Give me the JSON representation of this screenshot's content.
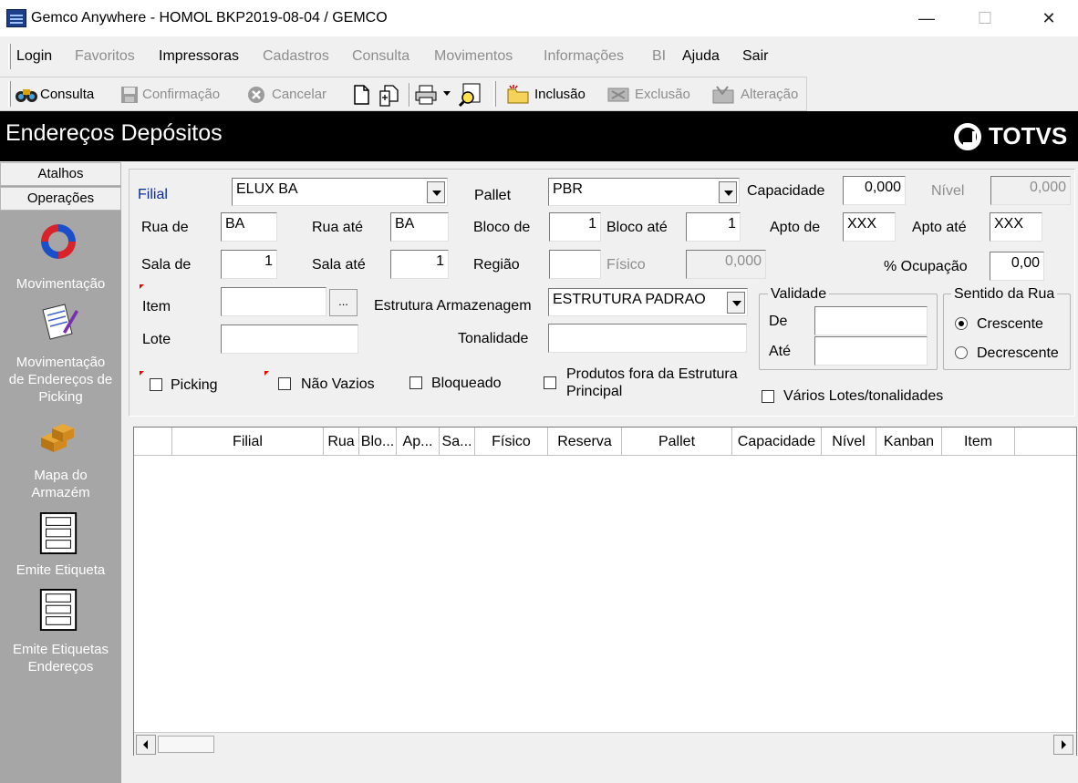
{
  "window": {
    "title": "Gemco Anywhere - HOMOL BKP2019-08-04 / GEMCO",
    "minimize": "—",
    "maximize": "☐",
    "close": "✕"
  },
  "menu": {
    "items": [
      {
        "label": "Login",
        "enabled": true
      },
      {
        "label": "Favoritos",
        "enabled": false
      },
      {
        "label": "Impressoras",
        "enabled": true
      },
      {
        "label": "Cadastros",
        "enabled": false
      },
      {
        "label": "Consulta",
        "enabled": false
      },
      {
        "label": "Movimentos",
        "enabled": false
      },
      {
        "label": "Informações",
        "enabled": false
      },
      {
        "label": "BI",
        "enabled": false
      },
      {
        "label": "Ajuda",
        "enabled": true
      },
      {
        "label": "Sair",
        "enabled": true
      }
    ]
  },
  "toolbar": {
    "consulta": "Consulta",
    "confirmacao": "Confirmação",
    "cancelar": "Cancelar",
    "inclusao": "Inclusão",
    "exclusao": "Exclusão",
    "alteracao": "Alteração"
  },
  "page": {
    "title": "Endereços Depósitos",
    "logo": "TOTVS"
  },
  "sidebar": {
    "tabs": [
      "Atalhos",
      "Operações"
    ],
    "items": [
      {
        "label1": "Movimentação",
        "label2": "",
        "label3": "",
        "icon": "refresh-icon"
      },
      {
        "label1": "Movimentação",
        "label2": "de Endereços de",
        "label3": "Picking",
        "icon": "document-pencil-icon"
      },
      {
        "label1": "Mapa do",
        "label2": "Armazém",
        "label3": "",
        "icon": "boxes-icon"
      },
      {
        "label1": "Emite Etiqueta",
        "label2": "",
        "label3": "",
        "icon": "label-sheet-icon"
      },
      {
        "label1": "Emite Etiquetas",
        "label2": "Endereços",
        "label3": "",
        "icon": "label-sheet-icon"
      }
    ]
  },
  "form": {
    "filial_label": "Filial",
    "filial_value": "ELUX BA",
    "pallet_label": "Pallet",
    "pallet_value": "PBR",
    "capacidade_label": "Capacidade",
    "capacidade_value": "0,000",
    "nivel_label": "Nível",
    "nivel_value": "0,000",
    "rua_de_label": "Rua de",
    "rua_de_value": "BA",
    "rua_ate_label": "Rua até",
    "rua_ate_value": "BA",
    "bloco_de_label": "Bloco de",
    "bloco_de_value": "1",
    "bloco_ate_label": "Bloco até",
    "bloco_ate_value": "1",
    "apto_de_label": "Apto de",
    "apto_de_value": "XXX",
    "apto_ate_label": "Apto até",
    "apto_ate_value": "XXX",
    "sala_de_label": "Sala de",
    "sala_de_value": "1",
    "sala_ate_label": "Sala até",
    "sala_ate_value": "1",
    "regiao_label": "Região",
    "regiao_value": "",
    "fisico_label": "Físico",
    "fisico_value": "0,000",
    "ocupacao_label": "% Ocupação",
    "ocupacao_value": "0,00",
    "item_label": "Item",
    "item_value": "",
    "item_lookup": "...",
    "estrutura_label": "Estrutura Armazenagem",
    "estrutura_value": "ESTRUTURA PADRAO",
    "lote_label": "Lote",
    "lote_value": "",
    "tonalidade_label": "Tonalidade",
    "tonalidade_value": "",
    "validade_title": "Validade",
    "validade_de_label": "De",
    "validade_de_value": "",
    "validade_ate_label": "Até",
    "validade_ate_value": "",
    "sentido_title": "Sentido da Rua",
    "crescente_label": "Crescente",
    "decrescente_label": "Decrescente",
    "picking_label": "Picking",
    "nao_vazios_label": "Não Vazios",
    "bloqueado_label": "Bloqueado",
    "produtos_fora_label1": "Produtos fora da Estrutura",
    "produtos_fora_label2": "Principal",
    "varios_lotes_label": "Vários Lotes/tonalidades"
  },
  "grid": {
    "columns": [
      "",
      "Filial",
      "Rua",
      "Blo...",
      "Ap...",
      "Sa...",
      "Físico",
      "Reserva",
      "Pallet",
      "Capacidade",
      "Nível",
      "Kanban",
      "Item"
    ],
    "rows": []
  }
}
